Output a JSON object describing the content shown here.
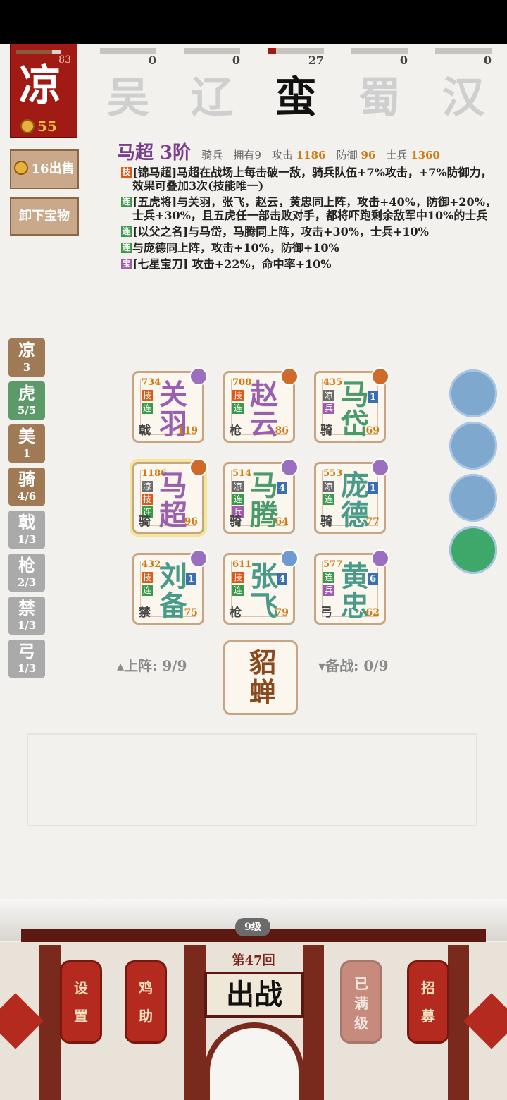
{
  "faction_card": {
    "name": "凉",
    "hp": 83,
    "hp_ratio": 0.8,
    "coins": "55"
  },
  "factions": [
    {
      "name": "吴",
      "count": "0",
      "progress": 0
    },
    {
      "name": "辽",
      "count": "0",
      "progress": 0
    },
    {
      "name": "蛮",
      "count": "27",
      "progress": 0.15,
      "selected": true
    },
    {
      "name": "蜀",
      "count": "0",
      "progress": 0
    },
    {
      "name": "汉",
      "count": "0",
      "progress": 0
    }
  ],
  "side_buttons": {
    "sell": "16出售",
    "unequip": "卸下宝物"
  },
  "hero": {
    "name": "马超 3阶",
    "class": "骑兵",
    "owned": "拥有9",
    "atk_label": "攻击",
    "atk": "1186",
    "def_label": "防御",
    "def": "96",
    "troops_label": "士兵",
    "troops": "1360",
    "skills": [
      {
        "tag": "技",
        "text": "[锦马超]马超在战场上每击破一敌，骑兵队伍+7%攻击，+7%防御力，效果可叠加3次(技能唯一)"
      },
      {
        "tag": "连",
        "text": "[五虎将]与关羽，张飞，赵云，黄忠同上阵，攻击+40%，防御+20%，士兵+30%，且五虎任一部击败对手，都将吓跑剩余敌军中10%的士兵"
      },
      {
        "tag": "连",
        "text": "[以父之名]与马岱，马腾同上阵，攻击+30%，士兵+10%"
      },
      {
        "tag": "连",
        "text": "与庞德同上阵，攻击+10%，防御+10%"
      },
      {
        "tag": "宝",
        "text": "[七星宝刀] 攻击+22%，命中率+10%"
      }
    ]
  },
  "filters": [
    {
      "c": "凉",
      "v": "3",
      "color": "#a07a55"
    },
    {
      "c": "虎",
      "v": "5/5",
      "color": "#5d9a6a"
    },
    {
      "c": "美",
      "v": "1",
      "color": "#a07a55"
    },
    {
      "c": "骑",
      "v": "4/6",
      "color": "#a07a55"
    },
    {
      "c": "戟",
      "v": "1/3",
      "color": "#aaaaaa"
    },
    {
      "c": "枪",
      "v": "2/3",
      "color": "#aaaaaa"
    },
    {
      "c": "禁",
      "v": "1/3",
      "color": "#aaaaaa"
    },
    {
      "c": "弓",
      "v": "1/3",
      "color": "#aaaaaa"
    }
  ],
  "cards": [
    {
      "n1": "关",
      "n2": "羽",
      "atk": "734",
      "def": "119",
      "cls": "戟",
      "color": "#9a5fae",
      "badges": [
        "技",
        "连"
      ],
      "eq": "#9a6fbf",
      "note": "2"
    },
    {
      "n1": "赵",
      "n2": "云",
      "atk": "708",
      "def": "86",
      "cls": "枪",
      "color": "#9a5fae",
      "badges": [
        "技",
        "连"
      ],
      "eq": "#d06a2a"
    },
    {
      "n1": "马",
      "n2": "岱",
      "atk": "435",
      "def": "69",
      "cls": "骑",
      "color": "#4a9a6a",
      "badges": [
        "凉",
        "兵"
      ],
      "eq": "#d06a2a",
      "lv": "1"
    },
    {
      "n1": "马",
      "n2": "超",
      "atk": "1186",
      "def": "96",
      "cls": "骑",
      "color": "#9a5fae",
      "badges": [
        "凉",
        "技",
        "连"
      ],
      "eq": "#d06a2a",
      "note": "3",
      "selected": true
    },
    {
      "n1": "马",
      "n2": "腾",
      "atk": "514",
      "def": "64",
      "cls": "骑",
      "color": "#4a9a6a",
      "badges": [
        "凉",
        "连",
        "兵"
      ],
      "eq": "#9a6fbf",
      "lv": "4"
    },
    {
      "n1": "庞",
      "n2": "德",
      "atk": "553",
      "def": "77",
      "cls": "骑",
      "color": "#4a9a8a",
      "badges": [
        "凉",
        "连"
      ],
      "eq": "#9a6fbf",
      "lv": "1"
    },
    {
      "n1": "刘",
      "n2": "备",
      "atk": "432",
      "def": "75",
      "cls": "禁",
      "color": "#4a9a8a",
      "badges": [
        "技",
        "连"
      ],
      "eq": "#9a6fbf",
      "lv": "1"
    },
    {
      "n1": "张",
      "n2": "飞",
      "atk": "611",
      "def": "79",
      "cls": "枪",
      "color": "#4a9a8a",
      "badges": [
        "技",
        "连"
      ],
      "eq": "#6f9ad0",
      "lv": "4",
      "note": "2"
    },
    {
      "n1": "黄",
      "n2": "忠",
      "atk": "577",
      "def": "62",
      "cls": "弓",
      "color": "#4a9a8a",
      "badges": [
        "连",
        "兵"
      ],
      "eq": "#9a6fbf",
      "lv": "6"
    }
  ],
  "deploy": {
    "on": "上阵: 9/9",
    "reserve": "备战: 0/9",
    "special": "貂蝉"
  },
  "bottom": {
    "level": "9级",
    "round": "第47回",
    "battle": "出战",
    "settings": "设置",
    "help": "鸡助",
    "maxed": "已满级",
    "recruit": "招募"
  }
}
